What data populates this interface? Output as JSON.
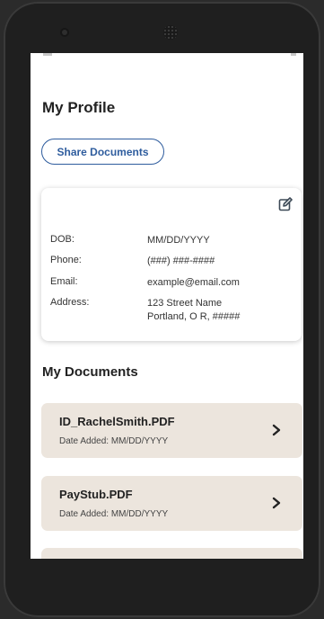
{
  "profile": {
    "title": "My Profile",
    "share_button": "Share Documents",
    "fields": [
      {
        "label": "DOB:",
        "value": "MM/DD/YYYY"
      },
      {
        "label": "Phone:",
        "value": "(###) ###-####"
      },
      {
        "label": "Email:",
        "value": "example@email.com"
      },
      {
        "label": "Address:",
        "value_line1": "123 Street Name",
        "value_line2": "Portland, O R, #####"
      }
    ]
  },
  "documents": {
    "title": "My Documents",
    "items": [
      {
        "name": "ID_RachelSmith.PDF",
        "date": "Date Added: MM/DD/YYYY"
      },
      {
        "name": "PayStub.PDF",
        "date": "Date Added: MM/DD/YYYY"
      }
    ]
  },
  "colors": {
    "accent": "#2f5d9e",
    "doc_card": "#ece5dd"
  },
  "icons": [
    "edit-icon",
    "chevron-right-icon"
  ]
}
